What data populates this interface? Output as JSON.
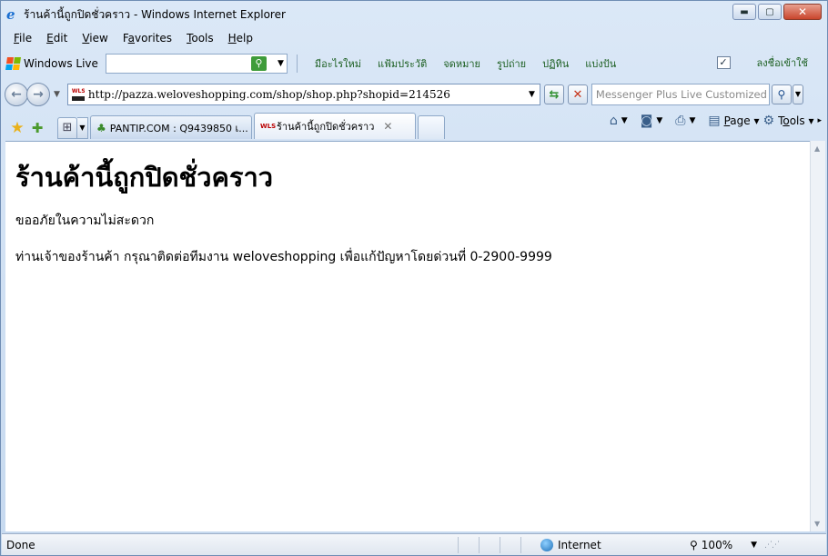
{
  "window": {
    "title": "ร้านค้านี้ถูกปิดชั่วคราว - Windows Internet Explorer",
    "minimize": "▭",
    "maximize": "▢",
    "close": "✕"
  },
  "menu": [
    {
      "label": "File",
      "key": "F"
    },
    {
      "label": "Edit",
      "key": "E"
    },
    {
      "label": "View",
      "key": "V"
    },
    {
      "label": "Favorites",
      "key": "a"
    },
    {
      "label": "Tools",
      "key": "T"
    },
    {
      "label": "Help",
      "key": "H"
    }
  ],
  "live_toolbar": {
    "brand": "Windows Live",
    "links": [
      "มีอะไรใหม่",
      "แฟ้มประวัติ",
      "จดหมาย",
      "รูปถ่าย",
      "ปฏิทิน",
      "แบ่งปัน"
    ],
    "signin": "ลงชื่อเข้าใช้"
  },
  "address": {
    "url": "http://pazza.weloveshopping.com/shop/shop.php?shopid=214526",
    "search_placeholder": "Messenger Plus Live Customized W"
  },
  "tabs": [
    {
      "label": "PANTIP.COM : Q9439850 เ...",
      "active": false
    },
    {
      "label": "ร้านค้านี้ถูกปิดชั่วคราว",
      "active": true
    }
  ],
  "commands": {
    "page": "Page",
    "tools": "Tools"
  },
  "page": {
    "heading": "ร้านค้านี้ถูกปิดชั่วคราว",
    "apology": "ขออภัยในความไม่สะดวก",
    "message": "ท่านเจ้าของร้านค้า กรุณาติดต่อทีมงาน weloveshopping เพื่อแก้ปัญหาโดยด่วนที่ 0-2900-9999"
  },
  "status": {
    "text": "Done",
    "zone": "Internet",
    "zoom": "100%"
  },
  "colors": {
    "chrome": "#cfe0f3",
    "flag_red": "#f25022",
    "flag_green": "#7fba00",
    "flag_blue": "#00a4ef",
    "flag_yellow": "#ffb900"
  }
}
